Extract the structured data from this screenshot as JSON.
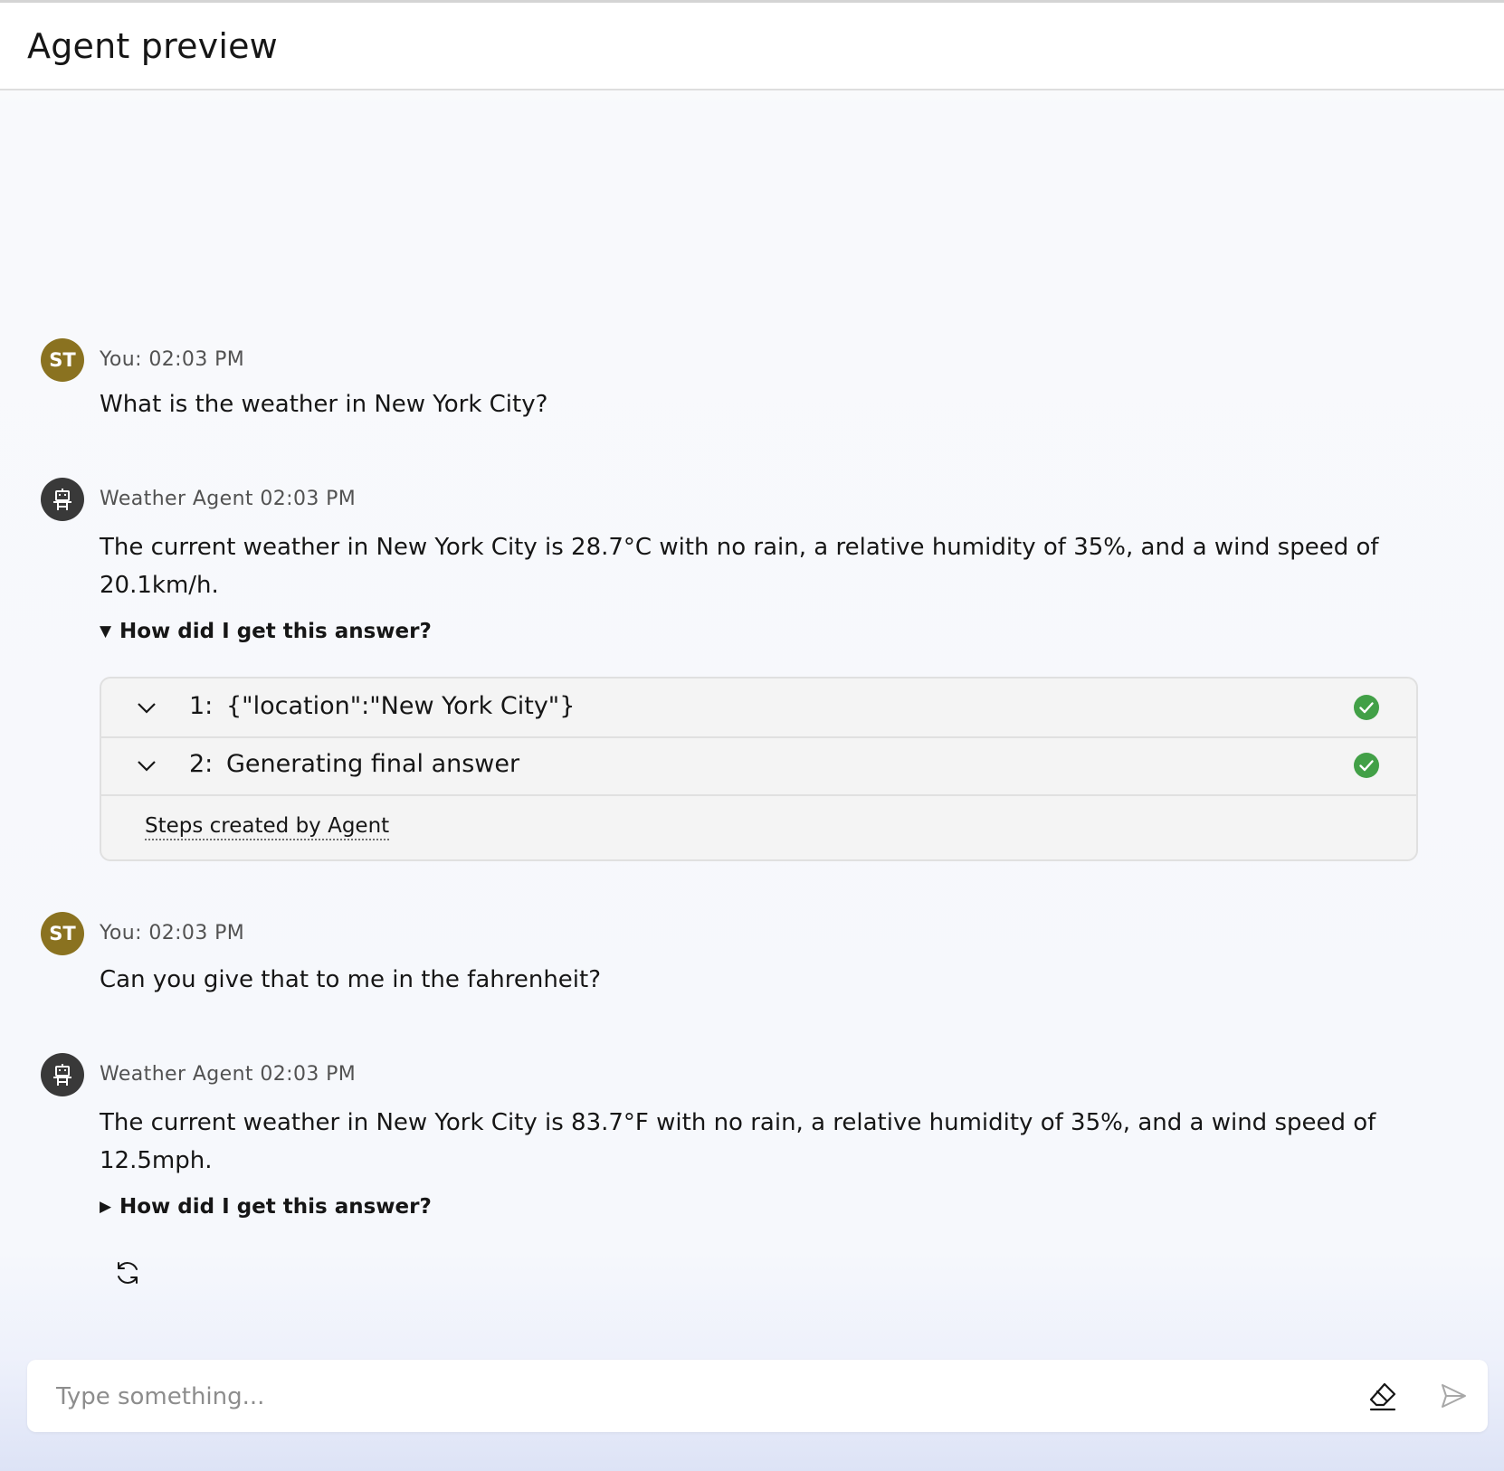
{
  "header": {
    "title": "Agent preview"
  },
  "messages": [
    {
      "role": "user",
      "avatar": "ST",
      "meta": "You: 02:03 PM",
      "text": "What is the weather in New York City?"
    },
    {
      "role": "agent",
      "avatar_icon": "robot-icon",
      "meta": "Weather Agent 02:03 PM",
      "text": "The current weather in New York City is 28.7°C with no rain, a relative humidity of 35%, and a wind speed of 20.1km/h.",
      "how_label": "How did I get this answer?",
      "expanded": true,
      "steps": [
        {
          "num": "1:",
          "label": "{\"location\":\"New York City\"}",
          "status": "complete"
        },
        {
          "num": "2:",
          "label": "Generating final answer",
          "status": "complete"
        }
      ],
      "steps_footer": "Steps created by Agent"
    },
    {
      "role": "user",
      "avatar": "ST",
      "meta": "You: 02:03 PM",
      "text": "Can you give that to me in the fahrenheit?"
    },
    {
      "role": "agent",
      "avatar_icon": "robot-icon",
      "meta": "Weather Agent 02:03 PM",
      "text": "The current weather in New York City is 83.7°F with no rain, a relative humidity of 35%, and a wind speed of 12.5mph.",
      "how_label": "How did I get this answer?",
      "expanded": false
    }
  ],
  "input": {
    "placeholder": "Type something..."
  },
  "icons": {
    "user_avatar_color": "#8a7220",
    "agent_avatar_color": "#393939",
    "check_color": "#42a047"
  }
}
